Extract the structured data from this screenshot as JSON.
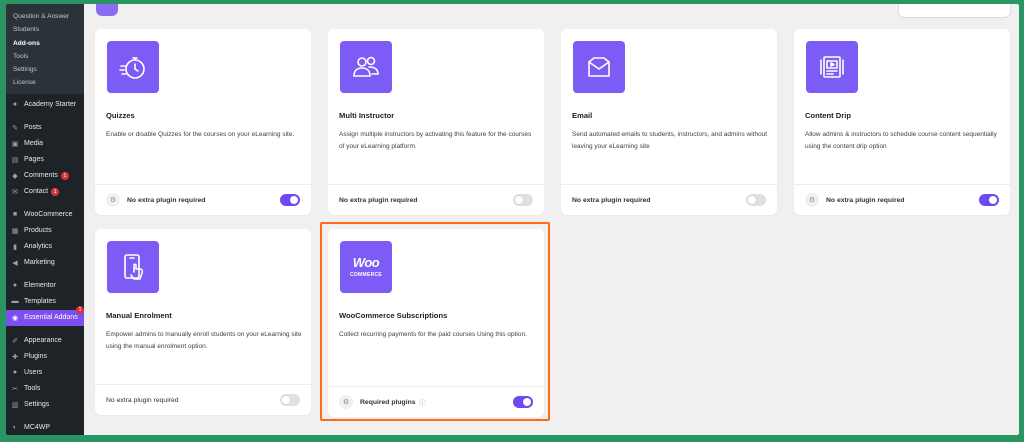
{
  "sidebar": {
    "submenu": [
      {
        "label": "Question & Answer",
        "active": false
      },
      {
        "label": "Students",
        "active": false
      },
      {
        "label": "Add-ons",
        "active": true
      },
      {
        "label": "Tools",
        "active": false
      },
      {
        "label": "Settings",
        "active": false
      },
      {
        "label": "License",
        "active": false
      }
    ],
    "menu": [
      {
        "label": "Academy Starter",
        "icon": "academy-icon"
      },
      {
        "label": "Posts",
        "icon": "pin-icon"
      },
      {
        "label": "Media",
        "icon": "media-icon"
      },
      {
        "label": "Pages",
        "icon": "pages-icon"
      },
      {
        "label": "Comments",
        "icon": "comments-icon",
        "badge": "1"
      },
      {
        "label": "Contact",
        "icon": "mail-icon",
        "badge": "1"
      },
      {
        "label": "WooCommerce",
        "icon": "woocommerce-icon"
      },
      {
        "label": "Products",
        "icon": "products-icon"
      },
      {
        "label": "Analytics",
        "icon": "analytics-icon"
      },
      {
        "label": "Marketing",
        "icon": "marketing-icon"
      },
      {
        "label": "Elementor",
        "icon": "elementor-icon"
      },
      {
        "label": "Templates",
        "icon": "templates-icon"
      },
      {
        "label": "Essential Addons",
        "icon": "ea-icon",
        "badge": "1",
        "active": true
      },
      {
        "label": "Appearance",
        "icon": "appearance-icon"
      },
      {
        "label": "Plugins",
        "icon": "plugins-icon"
      },
      {
        "label": "Users",
        "icon": "users-icon"
      },
      {
        "label": "Tools",
        "icon": "tools-icon"
      },
      {
        "label": "Settings",
        "icon": "settings-icon"
      },
      {
        "label": "MC4WP",
        "icon": "mc4wp-icon"
      }
    ]
  },
  "cards": [
    {
      "title": "Quizzes",
      "description": "Enable or disable Quizzes for the courses on your eLearning site.",
      "footer": "No extra plugin required",
      "enabled": true,
      "icon": "stopwatch-icon"
    },
    {
      "title": "Multi Instructor",
      "description": "Assign multiple instructors by activating this feature for the courses of your eLearning platform.",
      "footer": "No extra plugin required",
      "enabled": false,
      "icon": "users-group-icon"
    },
    {
      "title": "Email",
      "description": "Send automated emails to students, instructors, and admins without leaving your eLearning site",
      "footer": "No extra plugin required",
      "enabled": false,
      "icon": "envelope-icon"
    },
    {
      "title": "Content Drip",
      "description": "Allow admins & instructors to schedule course content sequentially using the content drip option",
      "footer": "No extra plugin required",
      "enabled": true,
      "icon": "video-lesson-icon"
    },
    {
      "title": "Manual Enrolment",
      "description": "Empower admins to manually enroll students on your eLearning site using the manual enrolment option.",
      "footer": "No extra plugin required",
      "enabled": false,
      "icon": "mobile-tap-icon"
    },
    {
      "title": "WooCommerce Subscriptions",
      "description": "Collect recurring payments for the paid courses Using this option.",
      "footer": "Required plugins",
      "enabled": true,
      "icon": "woocommerce-logo-icon",
      "highlighted": true
    }
  ],
  "woo_logo": {
    "top": "Woo",
    "bottom": "COMMERCE"
  },
  "colors": {
    "accent": "#7d5cf5",
    "toggle_on": "#6e48f0",
    "highlight": "#ff6a1f",
    "background": "#2a9462",
    "sidebar": "#1d2327"
  }
}
